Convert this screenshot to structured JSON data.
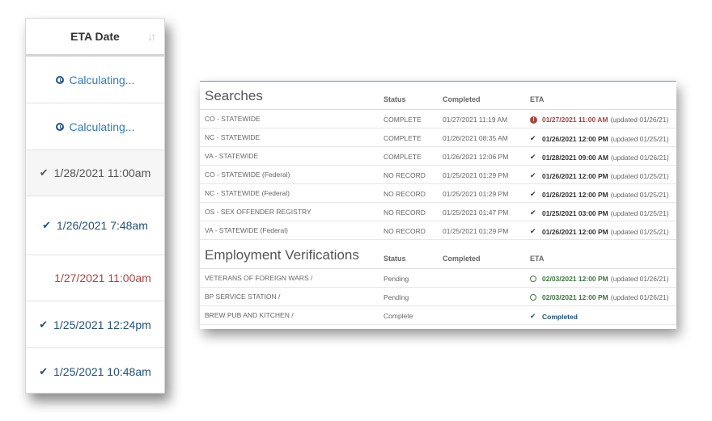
{
  "left": {
    "header": "ETA Date",
    "rows": [
      {
        "text": "Calculating...",
        "icon": "clock-icon",
        "style": "calc"
      },
      {
        "text": "Calculating...",
        "icon": "clock-icon",
        "style": "calc"
      },
      {
        "text": "1/28/2021 11:00am",
        "icon": "check-icon",
        "style": "gray"
      },
      {
        "text": "1/26/2021 7:48am",
        "icon": "check-icon",
        "style": "blue"
      },
      {
        "text": "1/27/2021 11:00am",
        "icon": "exclamation-icon",
        "style": "red"
      },
      {
        "text": "1/25/2021 12:24pm",
        "icon": "check-icon",
        "style": "blue"
      },
      {
        "text": "1/25/2021 10:48am",
        "icon": "check-icon",
        "style": "blue"
      }
    ]
  },
  "searches": {
    "title": "Searches",
    "col_status": "Status",
    "col_completed": "Completed",
    "col_eta": "ETA",
    "rows": [
      {
        "name": "CO - STATEWIDE",
        "status": "COMPLETE",
        "completed": "01/27/2021 11:19 AM",
        "eta": "01/27/2021 11:00 AM",
        "updated": "(updated 01/26/21)",
        "kind": "red"
      },
      {
        "name": "NC - STATEWIDE",
        "status": "COMPLETE",
        "completed": "01/26/2021 08:35 AM",
        "eta": "01/26/2021 12:00 PM",
        "updated": "(updated 01/25/21)",
        "kind": "dark"
      },
      {
        "name": "VA - STATEWIDE",
        "status": "COMPLETE",
        "completed": "01/26/2021 12:06 PM",
        "eta": "01/28/2021 09:00 AM",
        "updated": "(updated 01/26/21)",
        "kind": "dark"
      },
      {
        "name": "CO - STATEWIDE (Federal)",
        "status": "NO RECORD",
        "completed": "01/25/2021 01:29 PM",
        "eta": "01/26/2021 12:00 PM",
        "updated": "(updated 01/25/21)",
        "kind": "dark"
      },
      {
        "name": "NC - STATEWIDE (Federal)",
        "status": "NO RECORD",
        "completed": "01/25/2021 01:29 PM",
        "eta": "01/26/2021 12:00 PM",
        "updated": "(updated 01/25/21)",
        "kind": "dark"
      },
      {
        "name": "OS - SEX OFFENDER REGISTRY",
        "status": "NO RECORD",
        "completed": "01/25/2021 01:47 PM",
        "eta": "01/25/2021 03:00 PM",
        "updated": "(updated 01/25/21)",
        "kind": "dark"
      },
      {
        "name": "VA - STATEWIDE (Federal)",
        "status": "NO RECORD",
        "completed": "01/25/2021 01:29 PM",
        "eta": "01/26/2021 12:00 PM",
        "updated": "(updated 01/25/21)",
        "kind": "dark"
      }
    ]
  },
  "employment": {
    "title": "Employment Verifications",
    "col_status": "Status",
    "col_completed": "Completed",
    "col_eta": "ETA",
    "rows": [
      {
        "name": "VETERANS OF FOREIGN WARS /",
        "status": "Pending",
        "completed": "",
        "eta": "02/03/2021 12:00 PM",
        "updated": "(updated 01/26/21)",
        "kind": "green"
      },
      {
        "name": "BP SERVICE STATION /",
        "status": "Pending",
        "completed": "",
        "eta": "02/03/2021 12:00 PM",
        "updated": "(updated 01/26/21)",
        "kind": "green"
      },
      {
        "name": "BREW PUB AND KITCHEN /",
        "status": "Complete",
        "completed": "",
        "eta": "Completed",
        "updated": "",
        "kind": "blue"
      }
    ]
  },
  "colors": {
    "red": "#a94442",
    "green": "#3c763d",
    "blue": "#23527c",
    "accent_line": "#6e9ac9"
  }
}
